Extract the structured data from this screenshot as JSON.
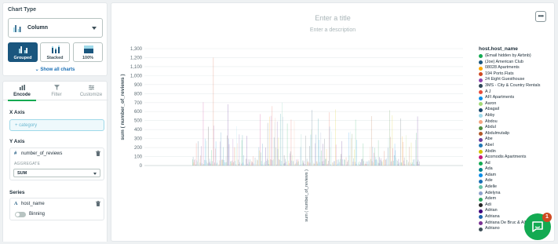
{
  "left_panel": {
    "chart_type": {
      "title": "Chart Type",
      "selected": "Column",
      "variants": [
        {
          "label": "Grouped",
          "active": true
        },
        {
          "label": "Stacked",
          "active": false
        },
        {
          "label": "100%",
          "active": false
        }
      ],
      "show_all": "Show all charts"
    },
    "tabs": [
      {
        "label": "Encode",
        "active": true,
        "icon": "encode-icon"
      },
      {
        "label": "Filter",
        "active": false,
        "icon": "filter-icon"
      },
      {
        "label": "Customize",
        "active": false,
        "icon": "customize-icon"
      }
    ],
    "x_axis": {
      "label": "X Axis",
      "placeholder": "+ category"
    },
    "y_axis": {
      "label": "Y Axis",
      "field": "number_of_reviews",
      "aggregate_label": "AGGREGATE",
      "aggregate": "SUM"
    },
    "series": {
      "label": "Series",
      "field": "host_name",
      "binning": "Binning"
    }
  },
  "canvas": {
    "title_placeholder": "Enter a title",
    "description_placeholder": "Enter a description",
    "more_label": "•••"
  },
  "chat": {
    "badge": "1"
  },
  "colors": {
    "accent": "#13aa52",
    "active_variant": "#1a567e",
    "link": "#1a6fb5"
  },
  "chart_data": {
    "type": "bar",
    "ylabel": "sum ( number_of_reviews )",
    "xlabel": "sum ( number_of_reviews )",
    "ylim": [
      0,
      1300
    ],
    "yticks": [
      0,
      100,
      200,
      300,
      400,
      500,
      600,
      700,
      800,
      900,
      1000,
      1100,
      1200,
      1300
    ],
    "ytick_labels": [
      "0",
      "100",
      "200",
      "300",
      "400",
      "500",
      "600",
      "700",
      "800",
      "900",
      "1,000",
      "1,100",
      "1,200",
      "1,300"
    ],
    "grid": true,
    "legend_title": "host.host_name",
    "legend_placement": "right",
    "series": [
      {
        "name": "(Email hidden by Airbnb)",
        "color": "#13aa52"
      },
      {
        "name": "(Joe)  American Club",
        "color": "#1a567e"
      },
      {
        "name": "08028 Apartments",
        "color": "#ffa900"
      },
      {
        "name": "194 Porto.Flats",
        "color": "#cf4a22"
      },
      {
        "name": "24 Eight Guesthouse",
        "color": "#8e44ad"
      },
      {
        "name": "3MS - City & Country Rentals",
        "color": "#2f4858"
      },
      {
        "name": "A J",
        "color": "#e74c3c"
      },
      {
        "name": "AFI Apartments",
        "color": "#0b8ee9"
      },
      {
        "name": "Aaron",
        "color": "#a3d977"
      },
      {
        "name": "Abagail",
        "color": "#17456b"
      },
      {
        "name": "Abby",
        "color": "#9fd9e9"
      },
      {
        "name": "Abdou",
        "color": "#f4a582"
      },
      {
        "name": "Abdul",
        "color": "#4b8b3b"
      },
      {
        "name": "Abdulmutalip",
        "color": "#b15928"
      },
      {
        "name": "Abe",
        "color": "#6a3d9a"
      },
      {
        "name": "Abel",
        "color": "#1f78b4"
      },
      {
        "name": "Abdin",
        "color": "#d4c200"
      },
      {
        "name": "Acomodis Apartments",
        "color": "#c51b7d"
      },
      {
        "name": "Ad",
        "color": "#13aa52"
      },
      {
        "name": "Ada",
        "color": "#02818a"
      },
      {
        "name": "Adam",
        "color": "#0b8ee9"
      },
      {
        "name": "Ade",
        "color": "#1a6fb5"
      },
      {
        "name": "Adelle",
        "color": "#66c2a5"
      },
      {
        "name": "Adelyna",
        "color": "#8da0cb"
      },
      {
        "name": "Adem",
        "color": "#2ca25f"
      },
      {
        "name": "Adi",
        "color": "#252525"
      },
      {
        "name": "Adrian",
        "color": "#3f007d"
      },
      {
        "name": "Adriana",
        "color": "#2166ac"
      },
      {
        "name": "Adriana De Bruc & Alberto",
        "color": "#7b3294"
      },
      {
        "name": "Adriano",
        "color": "#3d4f58"
      }
    ]
  }
}
